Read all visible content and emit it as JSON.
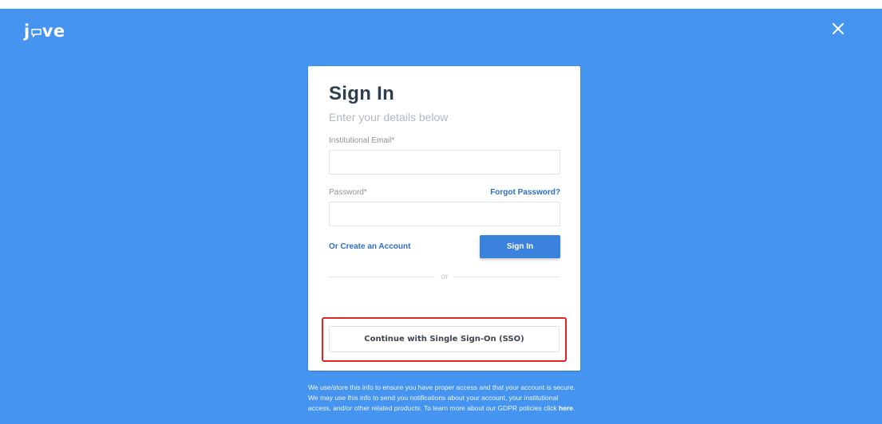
{
  "brand": {
    "logo_prefix": "j",
    "logo_suffix": "ve"
  },
  "colors": {
    "background": "#4595f0",
    "accent": "#3a82dc",
    "link": "#2d6ec4",
    "highlight": "#e02424"
  },
  "header": {
    "close_icon": "close-icon"
  },
  "signin": {
    "title": "Sign In",
    "subtitle": "Enter your details below",
    "email_label": "Institutional Email*",
    "email_value": "",
    "password_label": "Password*",
    "password_value": "",
    "forgot_label": "Forgot Password?",
    "create_account_label": "Or Create an Account",
    "signin_button_label": "Sign In",
    "divider_text": "or",
    "sso_button_label": "Continue with Single Sign-On (SSO)"
  },
  "footer": {
    "text": "We use/store this info to ensure you have proper access and that your account is secure. We may use this info to send you notifications about your account, your institutional access, and/or other related products. To learn more about our GDPR policies click ",
    "link_label": "here",
    "end": "."
  }
}
